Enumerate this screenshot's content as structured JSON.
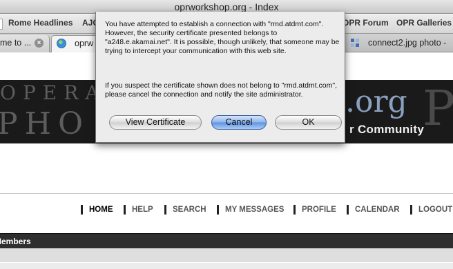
{
  "window": {
    "title": "oprworkshop.org - Index"
  },
  "bookmarks": {
    "items": [
      "Rome Headlines",
      "AJC",
      "OPR Forum",
      "OPR Galleries"
    ]
  },
  "tabs": [
    {
      "label": "me to ...",
      "close": "×"
    },
    {
      "label": "oprw"
    },
    {
      "label": "connect2.jpg photo -"
    }
  ],
  "header": {
    "logo_text": ".org",
    "tagline": "r Community",
    "letters_top": "OPERA",
    "letters_bottom": "PHO",
    "letters_right": "PH"
  },
  "nav": {
    "items": [
      "HOME",
      "HELP",
      "SEARCH",
      "MY MESSAGES",
      "PROFILE",
      "CALENDAR",
      "LOGOUT"
    ]
  },
  "members_label": "Members",
  "dialog": {
    "message1": "You have attempted to establish a connection with \"rmd.atdmt.com\". However, the security certificate presented belongs to \"a248.e.akamai.net\". It is possible, though unlikely, that someone may be trying to intercept your communication with this web site.",
    "message2": "If you suspect the certificate shown does not belong to \"rmd.atdmt.com\", please cancel the connection and notify the site administrator.",
    "view_certificate": "View Certificate",
    "cancel": "Cancel",
    "ok": "OK"
  }
}
